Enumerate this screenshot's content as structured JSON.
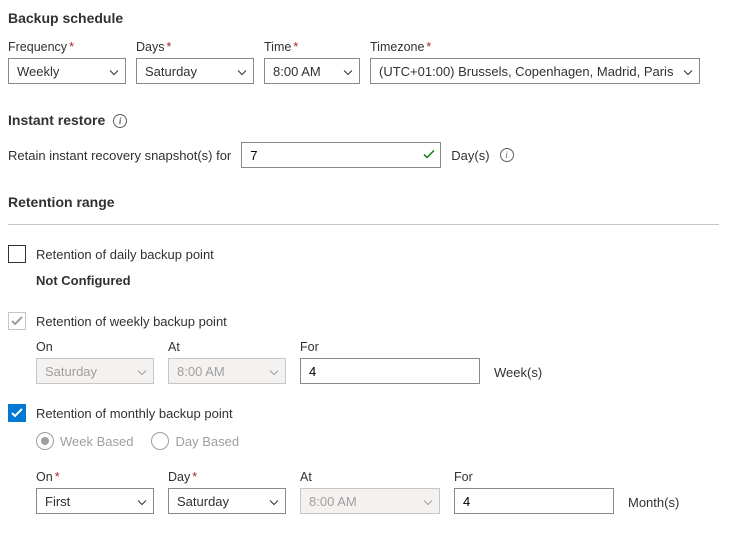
{
  "schedule": {
    "title": "Backup schedule",
    "frequency_label": "Frequency",
    "frequency_value": "Weekly",
    "days_label": "Days",
    "days_value": "Saturday",
    "time_label": "Time",
    "time_value": "8:00 AM",
    "timezone_label": "Timezone",
    "timezone_value": "(UTC+01:00) Brussels, Copenhagen, Madrid, Paris"
  },
  "instant": {
    "title": "Instant restore",
    "retain_label": "Retain instant recovery snapshot(s) for",
    "retain_value": "7",
    "unit": "Day(s)"
  },
  "retention": {
    "title": "Retention range",
    "daily": {
      "label": "Retention of daily backup point",
      "not_configured": "Not Configured"
    },
    "weekly": {
      "label": "Retention of weekly backup point",
      "on_label": "On",
      "on_value": "Saturday",
      "at_label": "At",
      "at_value": "8:00 AM",
      "for_label": "For",
      "for_value": "4",
      "unit": "Week(s)"
    },
    "monthly": {
      "label": "Retention of monthly backup point",
      "radio_week": "Week Based",
      "radio_day": "Day Based",
      "on_label": "On",
      "on_value": "First",
      "day_label": "Day",
      "day_value": "Saturday",
      "at_label": "At",
      "at_value": "8:00 AM",
      "for_label": "For",
      "for_value": "4",
      "unit": "Month(s)"
    }
  }
}
